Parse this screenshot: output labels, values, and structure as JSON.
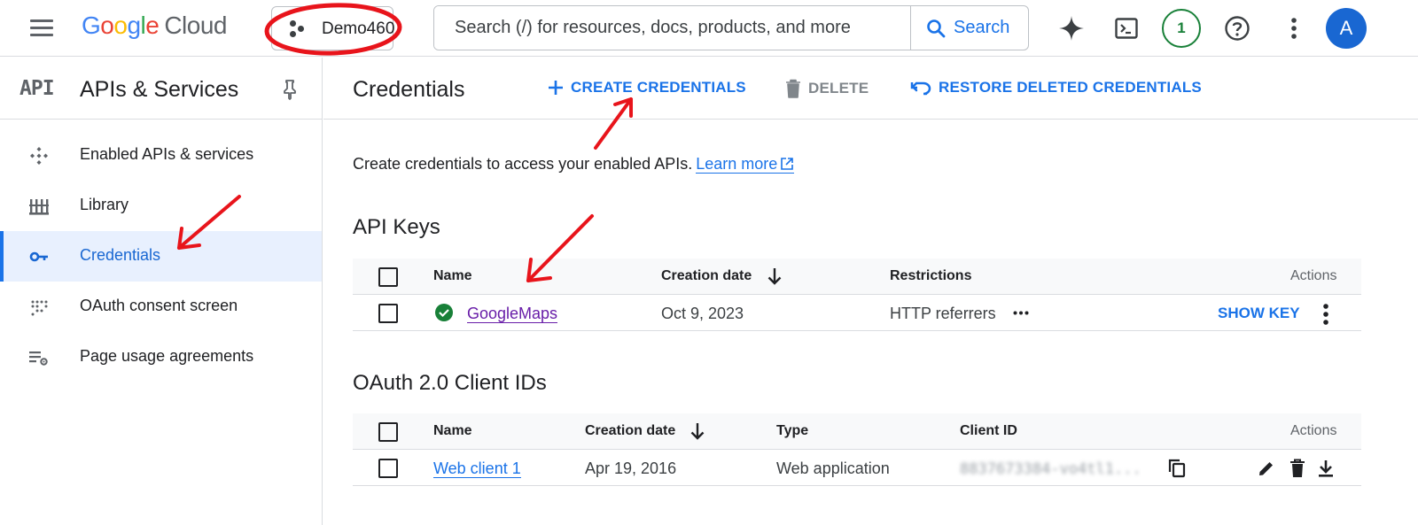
{
  "header": {
    "logo": {
      "g1": "G",
      "g2": "o",
      "g3": "o",
      "g4": "g",
      "g5": "l",
      "g6": "e",
      "cloud": "Cloud"
    },
    "project_name": "Demo460",
    "search_placeholder": "Search (/) for resources, docs, products, and more",
    "search_button": "Search",
    "notification_count": "1",
    "avatar_initial": "A"
  },
  "sidebar": {
    "badge": "API",
    "title": "APIs & Services",
    "items": [
      {
        "label": "Enabled APIs & services",
        "icon": "diamond-dots-icon",
        "active": false
      },
      {
        "label": "Library",
        "icon": "library-icon",
        "active": false
      },
      {
        "label": "Credentials",
        "icon": "key-icon",
        "active": true
      },
      {
        "label": "OAuth consent screen",
        "icon": "oauth-icon",
        "active": false
      },
      {
        "label": "Page usage agreements",
        "icon": "settings-list-icon",
        "active": false
      }
    ]
  },
  "main": {
    "title": "Credentials",
    "actions": {
      "create": "CREATE CREDENTIALS",
      "delete": "DELETE",
      "restore": "RESTORE DELETED CREDENTIALS"
    },
    "intro_text": "Create credentials to access your enabled APIs.",
    "learn_more": "Learn more",
    "api_keys": {
      "title": "API Keys",
      "headers": {
        "name": "Name",
        "creation_date": "Creation date",
        "restrictions": "Restrictions",
        "actions": "Actions"
      },
      "rows": [
        {
          "name": "GoogleMaps",
          "status": "enabled",
          "creation_date": "Oct 9, 2023",
          "restrictions": "HTTP referrers",
          "show_key": "SHOW KEY"
        }
      ]
    },
    "oauth_clients": {
      "title": "OAuth 2.0 Client IDs",
      "headers": {
        "name": "Name",
        "creation_date": "Creation date",
        "type": "Type",
        "client_id": "Client ID",
        "actions": "Actions"
      },
      "rows": [
        {
          "name": "Web client 1",
          "creation_date": "Apr 19, 2016",
          "type": "Web application",
          "client_id": "8837673384-vo4tl1..."
        }
      ]
    }
  },
  "colors": {
    "accent": "#1a73e8",
    "annotation": "#e8141b",
    "active_bg": "#e8f0fe",
    "success": "#188038",
    "visited_link": "#681da8"
  }
}
